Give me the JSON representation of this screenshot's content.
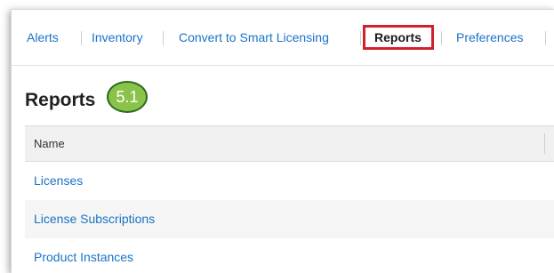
{
  "nav": {
    "tabs": [
      {
        "label": "Alerts"
      },
      {
        "label": "Inventory"
      },
      {
        "label": "Convert to Smart Licensing"
      },
      {
        "label": "Reports"
      },
      {
        "label": "Preferences"
      }
    ],
    "active_tab": "Reports"
  },
  "page": {
    "title": "Reports",
    "step_badge": "5.1"
  },
  "table": {
    "header": "Name",
    "rows": [
      {
        "name": "Licenses"
      },
      {
        "name": "License Subscriptions"
      },
      {
        "name": "Product Instances"
      }
    ]
  },
  "colors": {
    "link": "#1a73c5",
    "highlight": "#d3212c",
    "badge_fill": "#8bc34a",
    "badge_border": "#2e6b1f"
  }
}
